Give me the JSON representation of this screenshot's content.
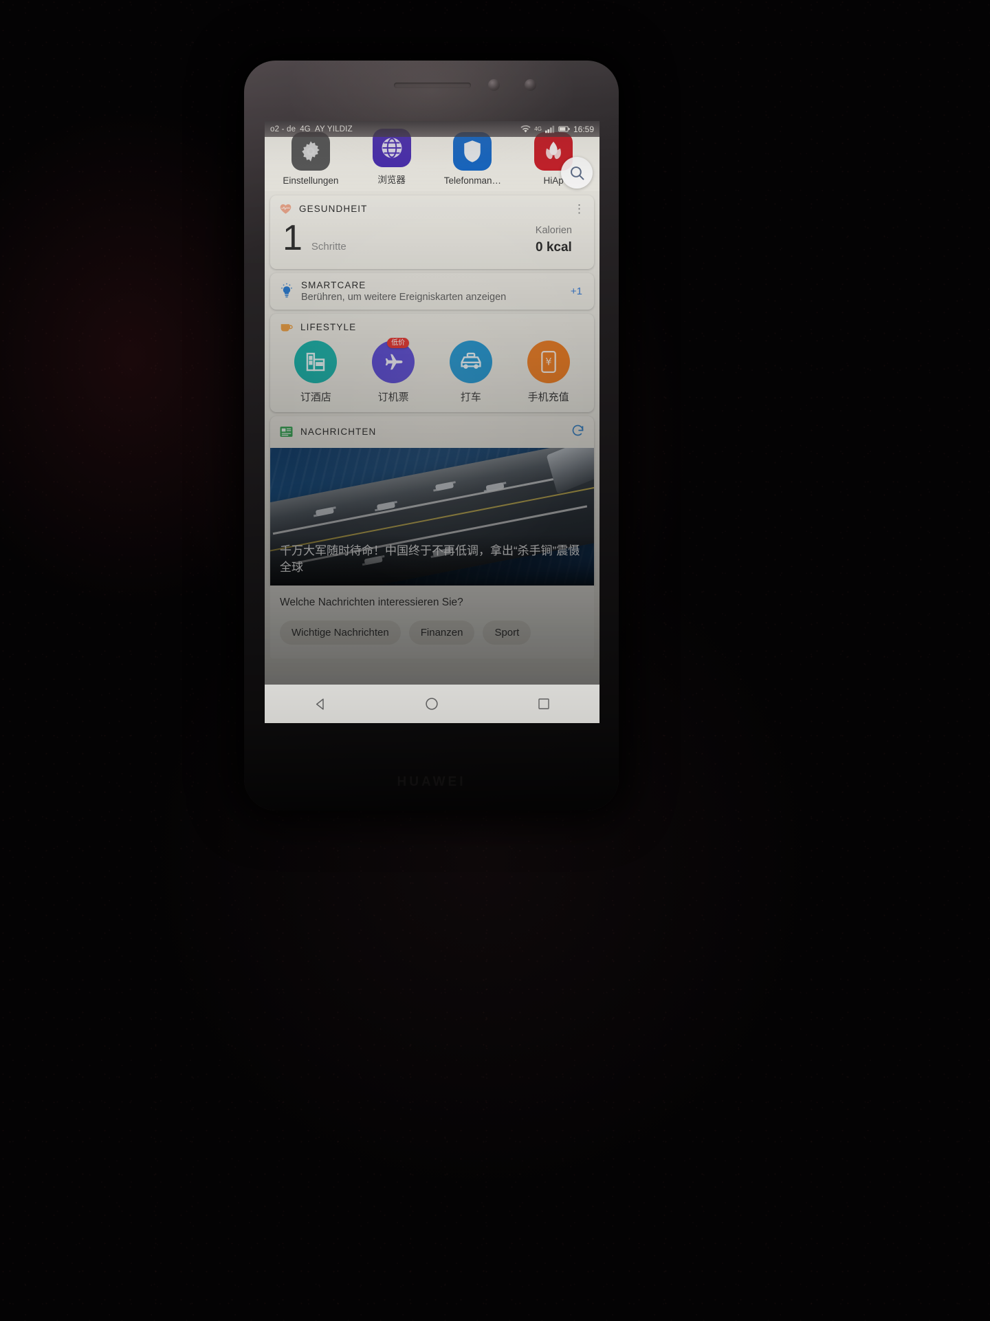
{
  "device": {
    "brand": "HUAWEI"
  },
  "statusbar": {
    "carrier_primary": "o2 - de",
    "carrier_network": "4G",
    "carrier_secondary": "AY YILDIZ",
    "wifi_icon": "wifi-icon",
    "signal_icon": "signal-icon",
    "battery_icon": "battery-icon",
    "clock": "16:59"
  },
  "apps": [
    {
      "label": "Einstellungen",
      "icon": "settings-gear-icon",
      "color": "#5a5a5a"
    },
    {
      "label": "浏览器",
      "icon": "browser-globe-icon",
      "color": "#4b2fb0"
    },
    {
      "label": "Telefonman…",
      "icon": "phone-manager-shield-icon",
      "color": "#1868c4"
    },
    {
      "label": "HiAp",
      "icon": "hiapp-petal-icon",
      "color": "#c8232c"
    }
  ],
  "search": {
    "icon": "search-icon",
    "label": "Suche"
  },
  "health": {
    "title": "GESUNDHEIT",
    "icon": "heart-pulse-icon",
    "icon_color": "#e9a58b",
    "menu_icon": "overflow-menu-icon",
    "steps_value": "1",
    "steps_label": "Schritte",
    "calories_label": "Kalorien",
    "calories_value": "0 kcal"
  },
  "smartcare": {
    "title": "SMARTCARE",
    "icon": "lightbulb-idea-icon",
    "icon_color": "#2f7ed0",
    "subtitle": "Berühren, um weitere Ereigniskarten anzeigen",
    "more_count": "+1"
  },
  "lifestyle": {
    "title": "LIFESTYLE",
    "icon": "coffee-cup-icon",
    "icon_color": "#eda349",
    "items": [
      {
        "label": "订酒店",
        "icon": "hotel-building-icon",
        "color": "#1fb5ad",
        "badge": ""
      },
      {
        "label": "订机票",
        "icon": "airplane-icon",
        "color": "#5b4bd6",
        "badge": "低价"
      },
      {
        "label": "打车",
        "icon": "taxi-car-icon",
        "color": "#2197d4",
        "badge": ""
      },
      {
        "label": "手机充值",
        "icon": "mobile-topup-icon",
        "color": "#f08026",
        "badge": ""
      }
    ]
  },
  "news": {
    "title": "NACHRICHTEN",
    "icon": "newspaper-icon",
    "icon_color": "#3cab5a",
    "refresh_icon": "refresh-icon",
    "headline": "千万大军随时待命！中国终于不再低调，拿出“杀手锏”震慑全球",
    "photo_alt": "aircraft-carrier-photo"
  },
  "interest": {
    "question": "Welche Nachrichten interessieren Sie?",
    "chips": [
      "Wichtige Nachrichten",
      "Finanzen",
      "Sport"
    ]
  },
  "navbar": {
    "back": "back-triangle-icon",
    "home": "home-circle-icon",
    "recents": "recents-square-icon"
  }
}
